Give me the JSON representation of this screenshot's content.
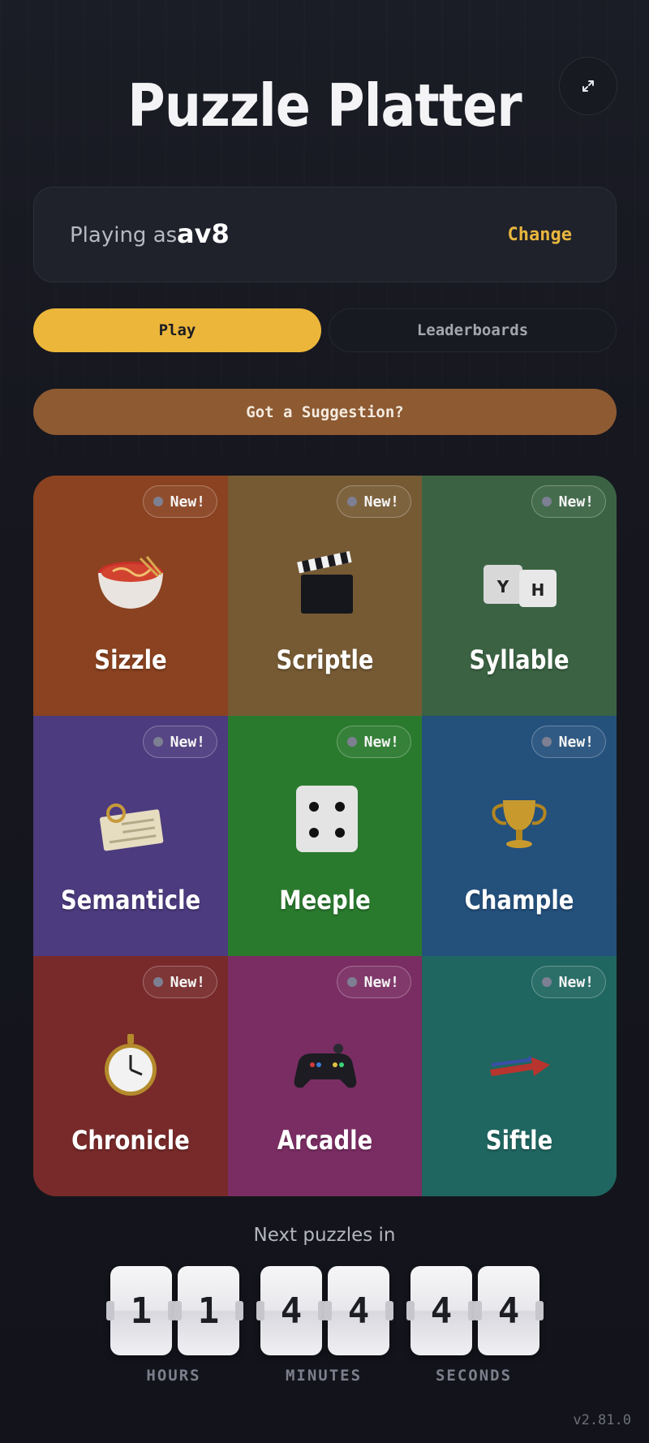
{
  "app": {
    "title": "Puzzle Platter",
    "version": "v2.81.0"
  },
  "expand_icon": "expand-arrows-icon",
  "player": {
    "label": "Playing as",
    "name": "av8",
    "change_label": "Change"
  },
  "tabs": [
    {
      "label": "Play",
      "active": true
    },
    {
      "label": "Leaderboards",
      "active": false
    }
  ],
  "suggestion_label": "Got a Suggestion?",
  "games": [
    {
      "name": "Sizzle",
      "badge": "New!",
      "color": "#8a4220",
      "icon": "noodle-bowl-icon"
    },
    {
      "name": "Scriptle",
      "badge": "New!",
      "color": "#765a34",
      "icon": "clapperboard-icon"
    },
    {
      "name": "Syllable",
      "badge": "New!",
      "color": "#3b6343",
      "icon": "letter-dice-icon"
    },
    {
      "name": "Semanticle",
      "badge": "New!",
      "color": "#4c3b7e",
      "icon": "magnifier-card-icon"
    },
    {
      "name": "Meeple",
      "badge": "New!",
      "color": "#2a7a2e",
      "icon": "die-icon"
    },
    {
      "name": "Chample",
      "badge": "New!",
      "color": "#24507c",
      "icon": "trophy-icon"
    },
    {
      "name": "Chronicle",
      "badge": "New!",
      "color": "#782a2a",
      "icon": "pocket-watch-icon"
    },
    {
      "name": "Arcadle",
      "badge": "New!",
      "color": "#7a2d63",
      "icon": "gamepad-icon"
    },
    {
      "name": "Siftle",
      "badge": "New!",
      "color": "#1f6660",
      "icon": "arrow-icon"
    }
  ],
  "countdown": {
    "label": "Next puzzles in",
    "hours": [
      "1",
      "1"
    ],
    "minutes": [
      "4",
      "4"
    ],
    "seconds": [
      "4",
      "4"
    ],
    "units": [
      "HOURS",
      "MINUTES",
      "SECONDS"
    ]
  },
  "colors": {
    "accent": "#ecb63b",
    "suggest": "#8d5a32",
    "background": "#14151c"
  }
}
